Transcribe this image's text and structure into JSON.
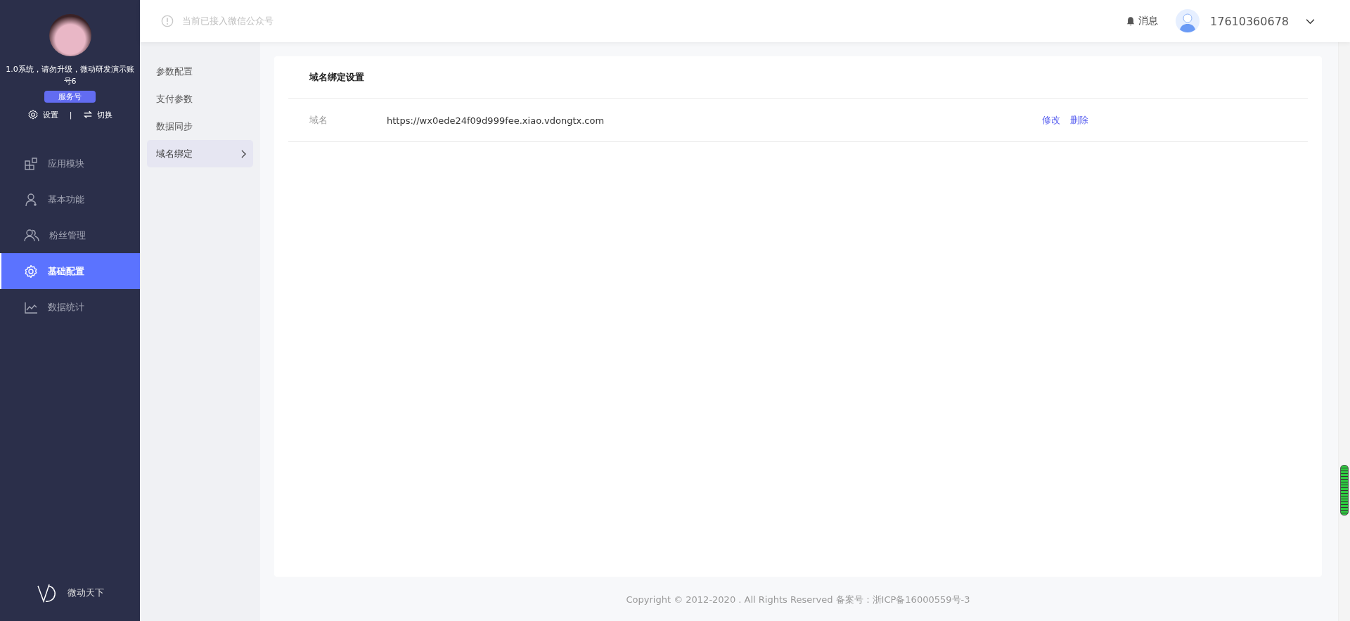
{
  "account": {
    "name": "1.0系统，请勿升级，微动研发演示账号6",
    "badge": "服务号",
    "settings": "设置",
    "separator": "|",
    "switch": "切换"
  },
  "nav": [
    {
      "label": "应用模块",
      "kind": "modules",
      "selected": false
    },
    {
      "label": "基本功能",
      "kind": "user",
      "selected": false
    },
    {
      "label": "粉丝管理",
      "kind": "fans",
      "selected": false
    },
    {
      "label": "基础配置",
      "kind": "config",
      "selected": true
    },
    {
      "label": "数据统计",
      "kind": "chart",
      "selected": false
    }
  ],
  "brand": "微动天下",
  "topbar": {
    "notice": "当前已接入微信公众号",
    "messages": "消息",
    "user": "17610360678"
  },
  "subnav": [
    {
      "label": "参数配置",
      "selected": false
    },
    {
      "label": "支付参数",
      "selected": false
    },
    {
      "label": "数据同步",
      "selected": false
    },
    {
      "label": "域名绑定",
      "selected": true
    }
  ],
  "card": {
    "title": "域名绑定设置",
    "rows": [
      {
        "label": "域名",
        "value": "https://wx0ede24f09d999fee.xiao.vdongtx.com",
        "actions": [
          "修改",
          "删除"
        ]
      }
    ]
  },
  "footer": "Copyright © 2012-2020 . All Rights Reserved 备案号：浙ICP备16000559号-3"
}
